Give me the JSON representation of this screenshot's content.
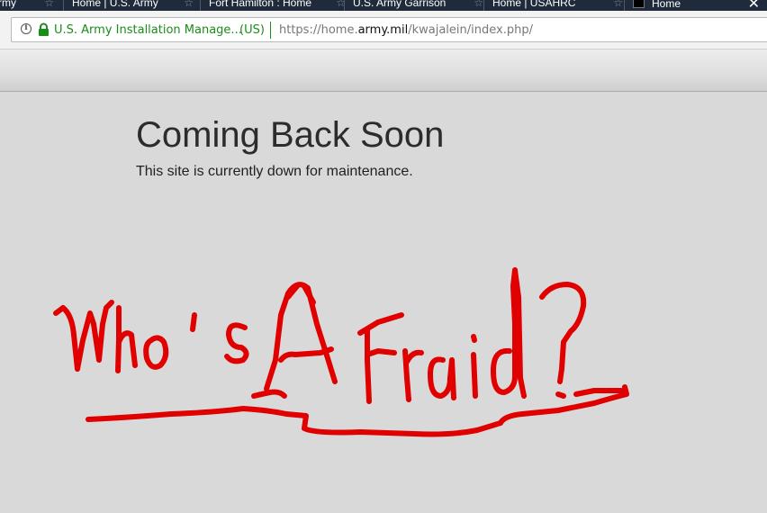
{
  "browser": {
    "tabs": [
      {
        "label": "rmy",
        "active": false
      },
      {
        "label": "Home | U.S. Army",
        "active": false
      },
      {
        "label": "Fort Hamilton : Home",
        "active": false
      },
      {
        "label": "U.S. Army Garrison",
        "active": false
      },
      {
        "label": "Home | USAHRC",
        "active": false
      },
      {
        "label": "Home",
        "active": true
      }
    ],
    "close_glyph": "✕",
    "star_glyph": "☆",
    "address_bar": {
      "site_identity": "U.S. Army Installation Manage...",
      "country": "(US)",
      "url_prefix": "https://home.",
      "url_domain": "army.mil",
      "url_path": "/kwajalein/index.php/",
      "secure_color": "#1a8c1a"
    }
  },
  "page": {
    "heading": "Coming Back Soon",
    "message": "This site is currently down for maintenance."
  },
  "annotation": {
    "text": "Who's Afraid?",
    "color": "#e00000"
  }
}
